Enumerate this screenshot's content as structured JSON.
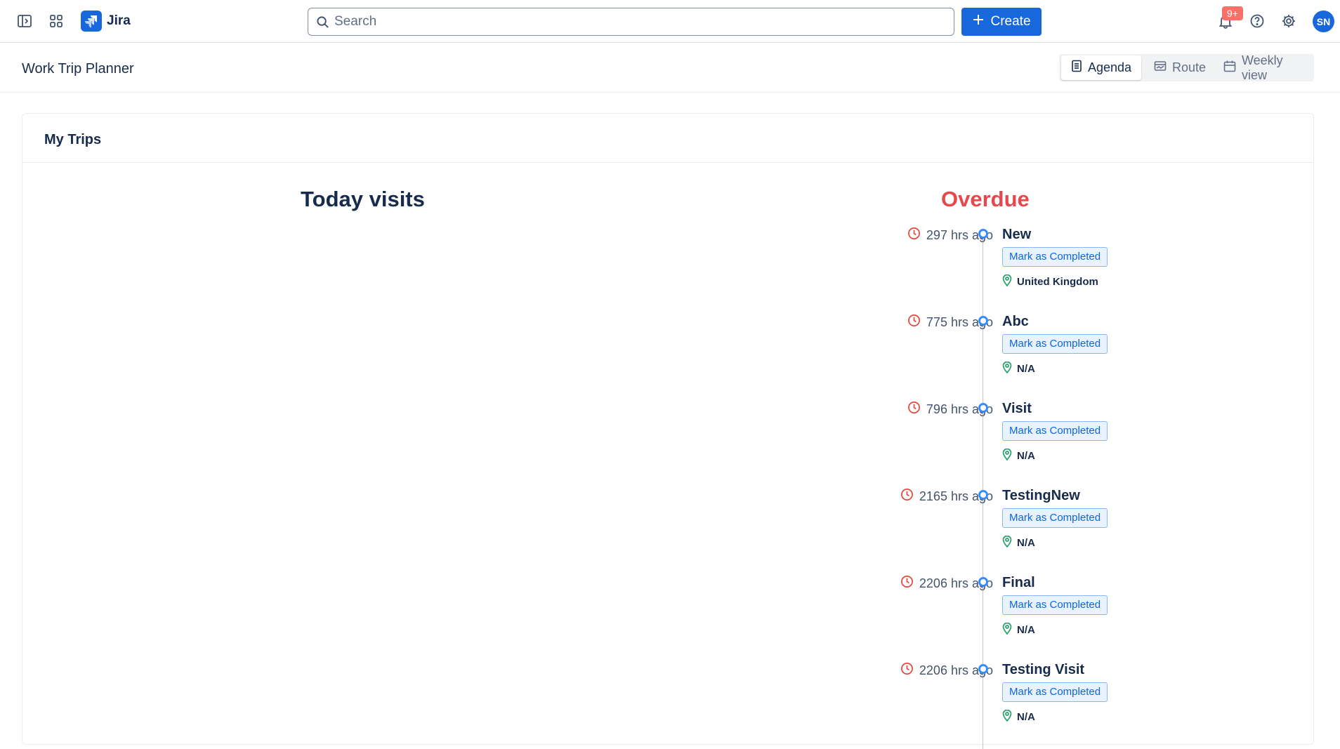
{
  "app": {
    "name": "Jira",
    "brand_color": "#1868db"
  },
  "topbar": {
    "search_placeholder": "Search",
    "create_label": "Create",
    "notifications_badge": "9+",
    "avatar_initials": "SN"
  },
  "page": {
    "title": "Work Trip Planner",
    "views": [
      {
        "label": "Agenda",
        "icon": "list-icon",
        "active": true
      },
      {
        "label": "Route",
        "icon": "route-icon",
        "active": false
      },
      {
        "label": "Weekly view",
        "icon": "calendar-icon",
        "active": false
      }
    ]
  },
  "card": {
    "title": "My Trips",
    "today_heading": "Today visits",
    "overdue_heading": "Overdue",
    "overdue_color": "#e5484d",
    "visits": [
      {
        "time": "297 hrs ago",
        "name": "New",
        "action": "Mark as Completed",
        "location": "United Kingdom"
      },
      {
        "time": "775 hrs ago",
        "name": "Abc",
        "action": "Mark as Completed",
        "location": "N/A"
      },
      {
        "time": "796 hrs ago",
        "name": "Visit",
        "action": "Mark as Completed",
        "location": "N/A"
      },
      {
        "time": "2165 hrs ago",
        "name": "TestingNew",
        "action": "Mark as Completed",
        "location": "N/A"
      },
      {
        "time": "2206 hrs ago",
        "name": "Final",
        "action": "Mark as Completed",
        "location": "N/A"
      },
      {
        "time": "2206 hrs ago",
        "name": "Testing Visit",
        "action": "Mark as Completed",
        "location": "N/A"
      }
    ]
  }
}
